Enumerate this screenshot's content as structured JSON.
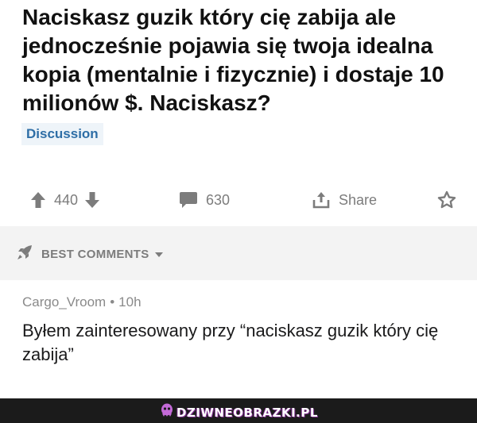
{
  "post": {
    "title": "Naciskasz guzik który cię zabija ale jednocześnie pojawia się twoja idealna kopia (mentalnie i fizycznie) i dostaje 10 milionów $. Naciskasz?",
    "flair": "Discussion"
  },
  "actions": {
    "upvotes": "440",
    "comments": "630",
    "share_label": "Share"
  },
  "sort": {
    "label": "BEST COMMENTS"
  },
  "comment": {
    "author": "Cargo_Vroom",
    "separator": "•",
    "time": "10h",
    "body": "Byłem zainteresowany przy “naciskasz guzik który cię zabija”"
  },
  "watermark": {
    "text": "DZIWNEOBRAZKI.PL"
  },
  "colors": {
    "meta_gray": "#7c7c7c",
    "flair_bg": "#eef4f9",
    "flair_text": "#2e6ea6",
    "band_bg": "#f3f3f3",
    "footer_bg": "#1b1b1b"
  },
  "icons": [
    "upvote-icon",
    "downvote-icon",
    "comment-bubble-icon",
    "share-icon",
    "award-icon",
    "rocket-icon",
    "caret-down-icon",
    "watermark-logo-icon"
  ]
}
